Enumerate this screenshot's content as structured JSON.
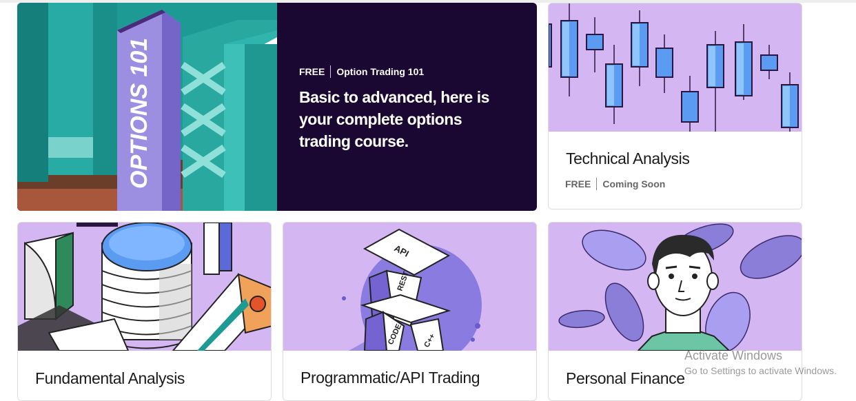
{
  "hero": {
    "badge": "FREE",
    "course": "Option Trading 101",
    "headline": "Basic to advanced, here is your complete options trading course.",
    "book_spine": "OPTIONS 101"
  },
  "cards": [
    {
      "title": "Technical Analysis",
      "badge": "FREE",
      "status": "Coming Soon"
    },
    {
      "title": "Fundamental Analysis"
    },
    {
      "title": "Programmatic/API Trading",
      "art_labels": [
        "API",
        "REST",
        "CODE",
        "C++"
      ]
    },
    {
      "title": "Personal Finance"
    }
  ],
  "watermark": {
    "line1": "Activate Windows",
    "line2": "Go to Settings to activate Windows."
  },
  "colors": {
    "hero_bg": "#1a0833",
    "card_art_bg": "#d4b6f3",
    "teal": "#1e9a94",
    "purple_accent": "#8a7be0",
    "candle_blue": "#5a9bf5"
  }
}
